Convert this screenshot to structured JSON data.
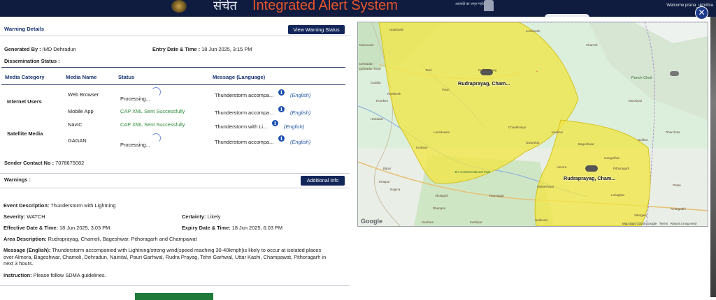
{
  "header": {
    "sachet_text": "संचेत",
    "title": "Integrated Alert System",
    "azadi_text": "आज़ादी का अमृत महोत्सव",
    "welcome_text": "Welcome prana_ukndma"
  },
  "close_glyph": "✕",
  "warning": {
    "section_title": "Warning Details",
    "view_button": "View Warning Status",
    "generated_by_label": "Generated By :",
    "generated_by_value": "IMD Dehradun",
    "entry_label": "Entry Date & Time :",
    "entry_value": "18 Jun 2025, 3:15 PM",
    "dissemination_label": "Dissemination Status :"
  },
  "table": {
    "headers": [
      "Media Category",
      "Media Name",
      "Status",
      "Message (Language)"
    ],
    "categories": [
      "Internet Users",
      "Satellite Media"
    ],
    "rows": [
      {
        "name": "Web Browser",
        "status": "Processing...",
        "message": "Thunderstorm accompa...",
        "lang": "(English)"
      },
      {
        "name": "Mobile App",
        "status": "CAP XML Sent Successfully",
        "message": "Thunderstorm accompa...",
        "lang": "(English)"
      },
      {
        "name": "NavIC",
        "status": "CAP XML Sent Successfully",
        "message": "Thunderstorm with Li...",
        "lang": "(English)"
      },
      {
        "name": "GAGAN",
        "status": "Processing...",
        "message": "Thunderstorm accompa...",
        "lang": "(English)"
      }
    ]
  },
  "sender": {
    "label": "Sender Contact No :",
    "value": "7078675082"
  },
  "warnings": {
    "title": "Warnings :",
    "additional_button": "Additional Info",
    "event_label": "Event Description:",
    "event_value": "Thunderstorm with Lightning",
    "severity_label": "Severity:",
    "severity_value": "WATCH",
    "certainty_label": "Certainty:",
    "certainty_value": "Likely",
    "effective_label": "Effective Date & Time:",
    "effective_value": "18 Jun 2025, 3:03 PM",
    "expiry_label": "Expiry Date & Time:",
    "expiry_value": "18 Jun 2025, 6:03 PM",
    "area_label": "Area Description:",
    "area_value": "Rudraprayag, Chamoli, Bageshwar, Pithoragarh and Champawat",
    "message_label": "Message (English):",
    "message_line1": "Thunderstorm accompanied with Lightning/strong wind(speed reaching 30-40kmph)is likely to occur at isolated places",
    "message_line2": "over Almora, Bageshwar, Chamoli, Dehradun, Nainital, Pauri Garhwal, Rudra Prayag, Tehri Garhwal, Uttar Kashi, Champawat, Pithoragarh in",
    "message_line3": "next 3 hours.",
    "instruction_label": "Instruction:",
    "instruction_value": "Please follow SDMA guidelines."
  },
  "map": {
    "area_label_1": "Rudraprayag, Cham...",
    "area_label_2": "Rudraprayag, Cham...",
    "google": "Google",
    "footer": [
      "Map data ©2025 Google",
      "Terms",
      "Report a map error"
    ],
    "places": [
      "Mussoorie",
      "Dehradun",
      "Uttarkashi",
      "Joshimath",
      "Chamoli",
      "Rudraprayag",
      "Tehri",
      "Panch Chuli",
      "Munsiyari",
      "Kausani",
      "Dharchula",
      "Rishikesh",
      "Haridwar",
      "Kotdwar",
      "Jim Corbett National Park",
      "Ramnagar",
      "Nagina",
      "Afzalgarh",
      "Dhampur",
      "Haldwani",
      "Pithoragarh",
      "Almora",
      "Mukteshwar",
      "Patan",
      "Amargadhi",
      "Sitarganj",
      "Kashipur",
      "Seohara",
      "Goalda",
      "Roorkee",
      "Kiratpur",
      "Bijnor",
      "Pauri",
      "Lansdowne",
      "Dwarahat",
      "Chaukhutiya",
      "Bageshwar",
      "Gangolihat",
      "Lohaghat",
      "Didihat",
      "Dehradun hindi"
    ],
    "brand_color": "#f0e64a"
  },
  "colors": {
    "navy": "#12265a",
    "accent": "#e8552a",
    "success": "#2d8a3a",
    "link": "#1f54a8",
    "alert_area": "#f0e64a"
  }
}
